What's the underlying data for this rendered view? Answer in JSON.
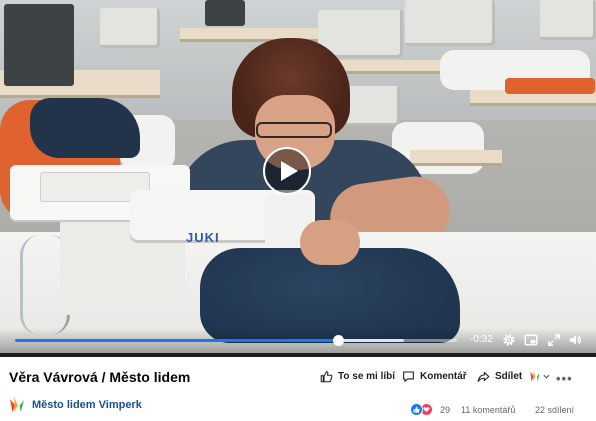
{
  "video": {
    "brand_label": "JUKI",
    "time_remaining": "-0:32",
    "progress_fraction": 0.73,
    "buffered_fraction": 0.88,
    "icons": [
      "play-icon",
      "gear-icon",
      "picture-in-picture-icon",
      "fullscreen-icon",
      "volume-icon"
    ]
  },
  "post": {
    "title": "Věra Vávrová / Město lidem",
    "actions": {
      "like": "To se mi líbí",
      "comment": "Komentář",
      "share": "Sdílet"
    },
    "more": "•••",
    "page_name": "Město lidem Vimperk",
    "reactions_count": "29",
    "comments": "11 komentářů",
    "shares": "22 sdílení"
  },
  "colors": {
    "accent": "#1877f2",
    "page_link": "#1b4f93",
    "text": "#050505",
    "muted": "#65676b"
  }
}
